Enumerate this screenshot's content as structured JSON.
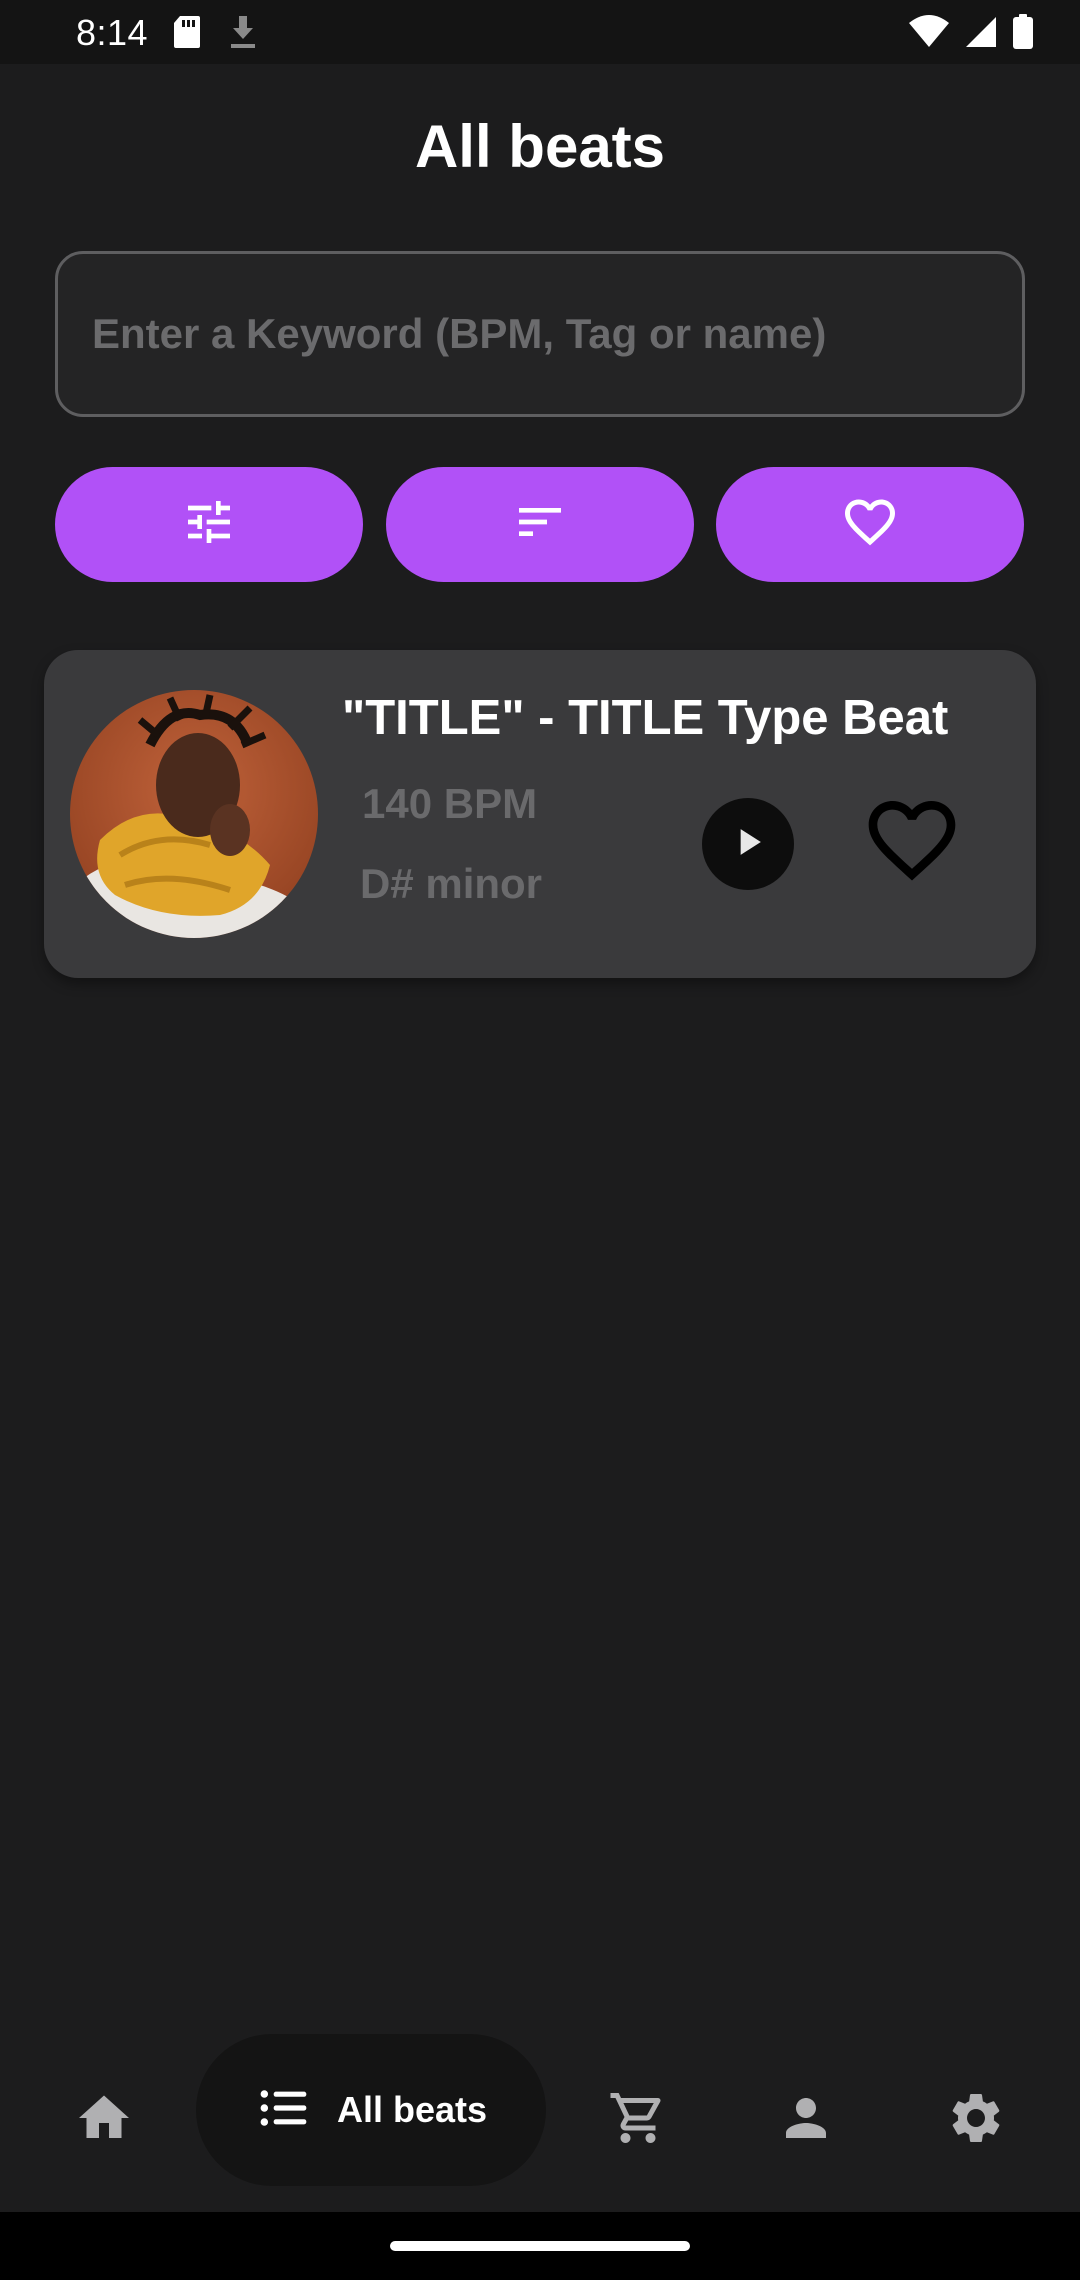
{
  "status_bar": {
    "time": "8:14",
    "left_icons": [
      "sd-card-icon",
      "download-icon"
    ],
    "right_icons": [
      "wifi-icon",
      "signal-icon",
      "battery-icon"
    ]
  },
  "header": {
    "title": "All beats"
  },
  "search": {
    "placeholder": "Enter a Keyword (BPM, Tag or name)",
    "value": ""
  },
  "actions": [
    {
      "name": "filter",
      "icon": "tune-icon"
    },
    {
      "name": "sort",
      "icon": "sort-icon"
    },
    {
      "name": "favorites",
      "icon": "heart-outline-icon"
    }
  ],
  "beats": [
    {
      "title": "\"TITLE\" - TITLE Type Beat",
      "bpm": "140 BPM",
      "key": "D# minor",
      "play_icon": "play-icon",
      "favorite_icon": "heart-outline-icon"
    }
  ],
  "bottom_nav": {
    "items": [
      {
        "name": "home",
        "icon": "home-icon"
      },
      {
        "name": "all-beats",
        "icon": "list-icon",
        "label": "All beats",
        "active": true
      },
      {
        "name": "cart",
        "icon": "cart-icon"
      },
      {
        "name": "profile",
        "icon": "person-icon"
      },
      {
        "name": "settings",
        "icon": "gear-icon"
      }
    ]
  },
  "colors": {
    "accent": "#b151f7",
    "background": "#1c1c1d",
    "card": "#3a3a3c",
    "muted_text": "#6a6a6c"
  }
}
